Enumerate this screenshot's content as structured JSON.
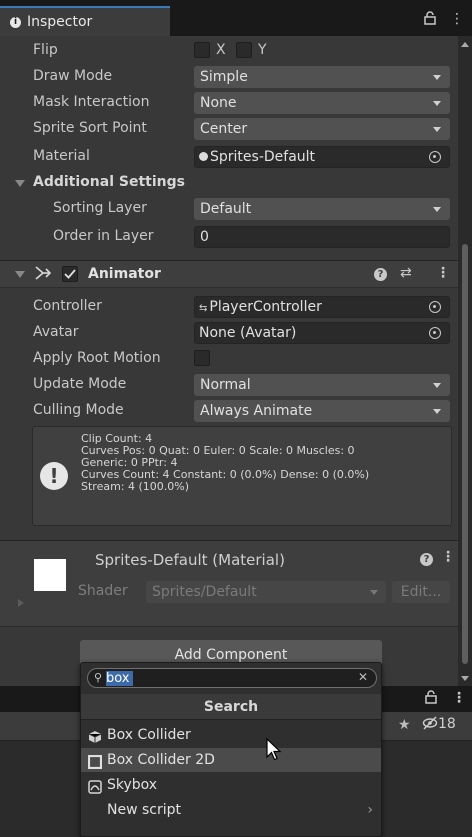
{
  "window": {
    "tab_title": "Inspector",
    "tab_icons": [
      "lock-icon",
      "kebab-menu-icon"
    ]
  },
  "sprite_renderer": {
    "flip": {
      "label": "Flip",
      "x_label": "X",
      "y_label": "Y",
      "x": false,
      "y": false
    },
    "draw_mode": {
      "label": "Draw Mode",
      "value": "Simple"
    },
    "mask_interaction": {
      "label": "Mask Interaction",
      "value": "None"
    },
    "sprite_sort_point": {
      "label": "Sprite Sort Point",
      "value": "Center"
    },
    "material": {
      "label": "Material",
      "value": "Sprites-Default"
    },
    "additional_settings": {
      "label": "Additional Settings",
      "sorting_layer": {
        "label": "Sorting Layer",
        "value": "Default"
      },
      "order_in_layer": {
        "label": "Order in Layer",
        "value": "0"
      }
    }
  },
  "animator": {
    "title": "Animator",
    "enabled": true,
    "controller": {
      "label": "Controller",
      "value": "PlayerController"
    },
    "avatar": {
      "label": "Avatar",
      "value": "None (Avatar)"
    },
    "apply_root_motion": {
      "label": "Apply Root Motion",
      "checked": false
    },
    "update_mode": {
      "label": "Update Mode",
      "value": "Normal"
    },
    "culling_mode": {
      "label": "Culling Mode",
      "value": "Always Animate"
    },
    "info": "Clip Count: 4\nCurves Pos: 0 Quat: 0 Euler: 0 Scale: 0 Muscles: 0\nGeneric: 0 PPtr: 4\nCurves Count: 4 Constant: 0 (0.0%) Dense: 0 (0.0%)\nStream: 4 (100.0%)"
  },
  "material_preview": {
    "name": "Sprites-Default (Material)",
    "shader_label": "Shader",
    "shader_value": "Sprites/Default",
    "edit_label": "Edit..."
  },
  "add_component": {
    "button_label": "Add Component",
    "search_query": "box",
    "search_title": "Search",
    "results": [
      {
        "label": "Box Collider",
        "icon": "box-collider-icon"
      },
      {
        "label": "Box Collider 2D",
        "icon": "box-collider-2d-icon"
      },
      {
        "label": "Skybox",
        "icon": "skybox-icon"
      },
      {
        "label": "New script",
        "icon": ""
      }
    ]
  },
  "lower_panel": {
    "visibility_count": "18"
  }
}
